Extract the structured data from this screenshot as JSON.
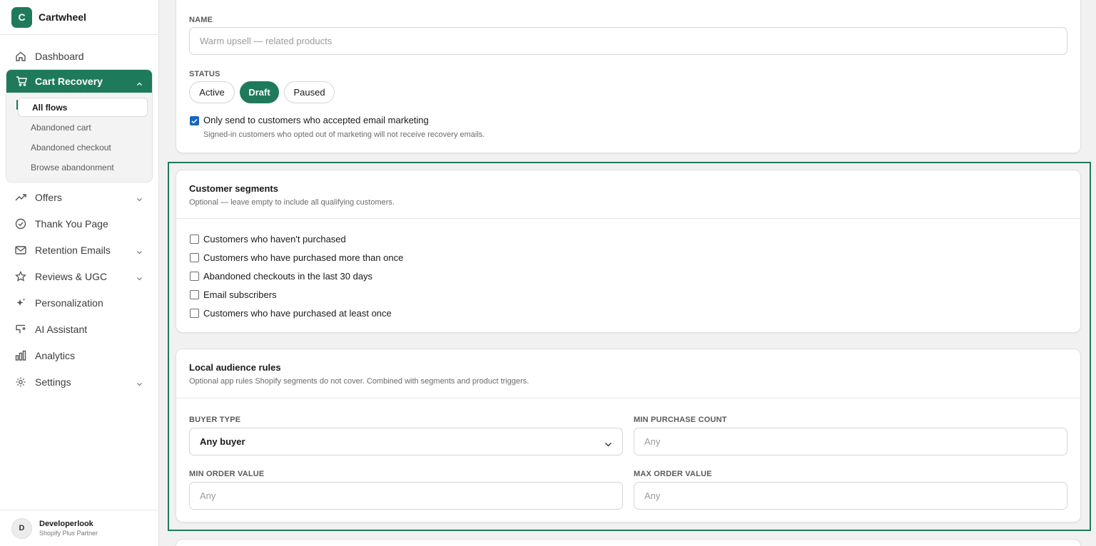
{
  "brand": {
    "logo_letter": "C",
    "name": "Cartwheel",
    "accent": "#1f7a5c"
  },
  "nav": {
    "dashboard": "Dashboard",
    "cart_recovery": "Cart Recovery",
    "cart_sub": [
      "All flows",
      "Abandoned cart",
      "Abandoned checkout",
      "Browse abandonment"
    ],
    "offers": "Offers",
    "thank_you": "Thank You Page",
    "retention": "Retention Emails",
    "reviews": "Reviews & UGC",
    "personalization": "Personalization",
    "ai": "AI Assistant",
    "analytics": "Analytics",
    "settings": "Settings"
  },
  "user": {
    "initial": "D",
    "name": "Developerlook",
    "role": "Shopify Plus Partner"
  },
  "general": {
    "name_label": "NAME",
    "name_placeholder": "Warm upsell — related products",
    "status_label": "STATUS",
    "status_options": [
      "Active",
      "Draft",
      "Paused"
    ],
    "status_selected": "Draft",
    "marketing_checkbox": "Only send to customers who accepted email marketing",
    "marketing_checked": true,
    "marketing_help": "Signed-in customers who opted out of marketing will not receive recovery emails."
  },
  "segments": {
    "title": "Customer segments",
    "subtitle": "Optional — leave empty to include all qualifying customers.",
    "options": [
      "Customers who haven't purchased",
      "Customers who have purchased more than once",
      "Abandoned checkouts in the last 30 days",
      "Email subscribers",
      "Customers who have purchased at least once"
    ]
  },
  "audience": {
    "title": "Local audience rules",
    "subtitle": "Optional app rules Shopify segments do not cover. Combined with segments and product triggers.",
    "buyer_type_label": "BUYER TYPE",
    "buyer_type_value": "Any buyer",
    "min_purchase_label": "MIN PURCHASE COUNT",
    "min_purchase_placeholder": "Any",
    "min_order_label": "MIN ORDER VALUE",
    "min_order_placeholder": "Any",
    "max_order_label": "MAX ORDER VALUE",
    "max_order_placeholder": "Any"
  }
}
